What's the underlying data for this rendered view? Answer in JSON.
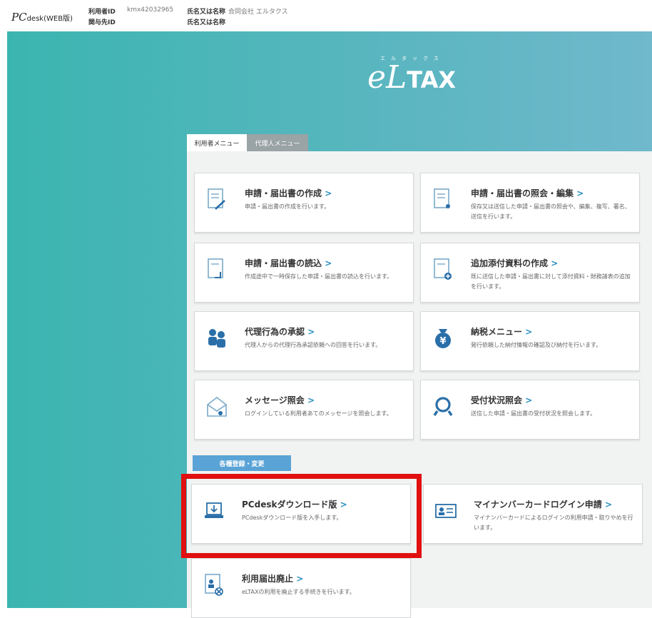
{
  "header": {
    "brand_pc": "PC",
    "brand_desk": "desk",
    "brand_edition": "(WEB版)",
    "user_id_label": "利用者ID",
    "user_id_value": "kmx42032965",
    "assoc_id_label": "関与先ID",
    "name_label_1": "氏名又は名称",
    "name_value_1": "合同会社 エルタクス",
    "name_label_2": "氏名又は名称"
  },
  "logo": {
    "e": "e",
    "l": "L",
    "tax": "TAX",
    "ruby": "エルタックス"
  },
  "tabs": [
    {
      "label": "利用者メニュー"
    },
    {
      "label": "代理人メニュー"
    }
  ],
  "cards": [
    {
      "title": "申請・届出書の作成",
      "desc": "申請・届出書の作成を行います。",
      "icon": "document-edit-icon"
    },
    {
      "title": "申請・届出書の照会・編集",
      "desc": "保存又は送信した申請・届出書の照会や、編集、複写、署名、送信を行います。",
      "icon": "document-search-icon"
    },
    {
      "title": "申請・届出書の読込",
      "desc": "作成途中で一時保存した申請・届出書の読込を行います。",
      "icon": "document-load-icon"
    },
    {
      "title": "追加添付資料の作成",
      "desc": "既に送信した申請・届出書に対して添付資料・財務諸表の追加を行います。",
      "icon": "document-attach-icon"
    },
    {
      "title": "代理行為の承認",
      "desc": "代理人からの代理行為承認依頼への回答を行います。",
      "icon": "proxy-users-icon"
    },
    {
      "title": "納税メニュー",
      "desc": "発行依頼した納付情報の確認及び納付を行います。",
      "icon": "tax-payment-icon"
    },
    {
      "title": "メッセージ照会",
      "desc": "ログインしている利用者あてのメッセージを照会します。",
      "icon": "message-icon"
    },
    {
      "title": "受付状況照会",
      "desc": "送信した申請・届出書の受付状況を照会します。",
      "icon": "search-status-icon"
    }
  ],
  "section_label": "各種登録・変更",
  "reg_cards": [
    {
      "title": "PCdeskダウンロード版",
      "desc": "PCdeskダウンロード版を入手します。",
      "icon": "download-icon"
    },
    {
      "title": "マイナンバーカードログイン申請",
      "desc": "マイナンバーカードによるログインの利用申請・取りやめを行います。",
      "icon": "id-card-icon"
    },
    {
      "title": "利用届出廃止",
      "desc": "eLTAXの利用を廃止する手続きを行います。",
      "icon": "cancel-registration-icon"
    }
  ],
  "colors": {
    "teal": "#3bb5b0",
    "accent_blue": "#2a8fc1",
    "section_blue": "#5aa3d6",
    "highlight_red": "#e10f0f"
  }
}
